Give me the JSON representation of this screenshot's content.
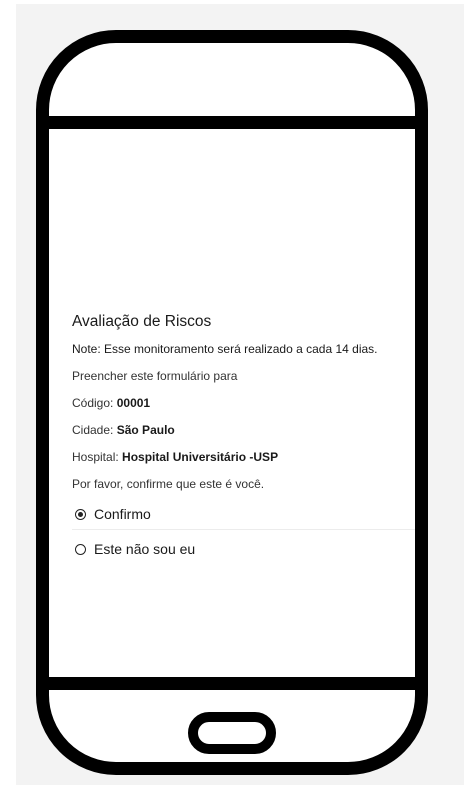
{
  "form": {
    "title": "Avaliação de Riscos",
    "note": "Note: Esse monitoramento será realizado a cada 14 dias.",
    "intro": "Preencher este formulário para",
    "codigo_label": "Código:",
    "codigo_value": "00001",
    "cidade_label": "Cidade:",
    "cidade_value": "São Paulo",
    "hospital_label": "Hospital:",
    "hospital_value": "Hospital Universitário -USP",
    "confirm_prompt": "Por favor, confirme que este é você.",
    "options": [
      {
        "label": "Confirmo",
        "selected": true
      },
      {
        "label": "Este não sou eu",
        "selected": false
      }
    ]
  }
}
